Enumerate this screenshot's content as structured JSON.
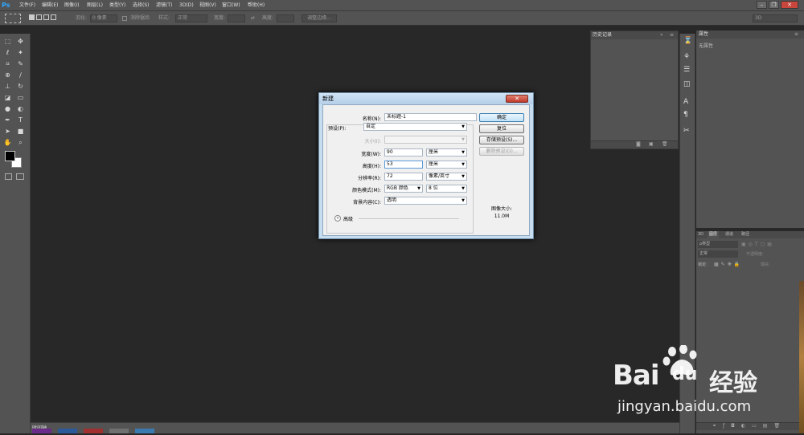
{
  "app": {
    "logo": "Ps"
  },
  "menubar": {
    "items": [
      "文件(F)",
      "编辑(E)",
      "图像(I)",
      "图层(L)",
      "类型(Y)",
      "选择(S)",
      "滤镜(T)",
      "3D(D)",
      "视图(V)",
      "窗口(W)",
      "帮助(H)"
    ]
  },
  "options_bar": {
    "feather_label": "羽化:",
    "feather_value": "0 像素",
    "antialias_label": "消除锯齿",
    "style_label": "样式:",
    "style_value": "正常",
    "width_label": "宽度:",
    "height_label": "高度:",
    "refine_edge": "调整边缘...",
    "workspace": "3D"
  },
  "history_panel": {
    "title": "历史记录"
  },
  "properties_panel": {
    "title": "属性",
    "content": "无属性"
  },
  "layers_panel": {
    "tabs": [
      "3D",
      "图层",
      "通道",
      "路径"
    ],
    "kind_label": "ρ类型",
    "blend_mode": "正常",
    "opacity_label": "不透明度:",
    "lock_label": "锁定:",
    "fill_label": "填充:"
  },
  "timeline": {
    "label": "时间轴"
  },
  "dialog": {
    "title": "新建",
    "name_label": "名称(N):",
    "name_value": "未标题-1",
    "preset_label": "预设(P):",
    "preset_value": "自定",
    "size_label": "大小(I):",
    "width_label": "宽度(W):",
    "width_value": "90",
    "width_unit": "厘米",
    "height_label": "高度(H):",
    "height_value": "53",
    "height_unit": "厘米",
    "resolution_label": "分辨率(R):",
    "resolution_value": "72",
    "resolution_unit": "像素/英寸",
    "color_mode_label": "颜色模式(M):",
    "color_mode_value": "RGB 颜色",
    "bit_depth_value": "8 位",
    "background_label": "背景内容(C):",
    "background_value": "透明",
    "advanced_label": "高级",
    "ok_button": "确定",
    "reset_button": "复位",
    "save_preset_button": "存储预设(S)...",
    "delete_preset_button": "删除预设(D)...",
    "image_size_label": "图像大小:",
    "image_size_value": "11.0M"
  },
  "watermark": {
    "brand": "Bai",
    "brand2": "du",
    "suffix": "经验",
    "url": "jingyan.baidu.com"
  },
  "colors": {
    "accent": "#31a8ff",
    "panel": "#535353",
    "canvas": "#282828",
    "dialog_frame": "#c6ddf0"
  }
}
